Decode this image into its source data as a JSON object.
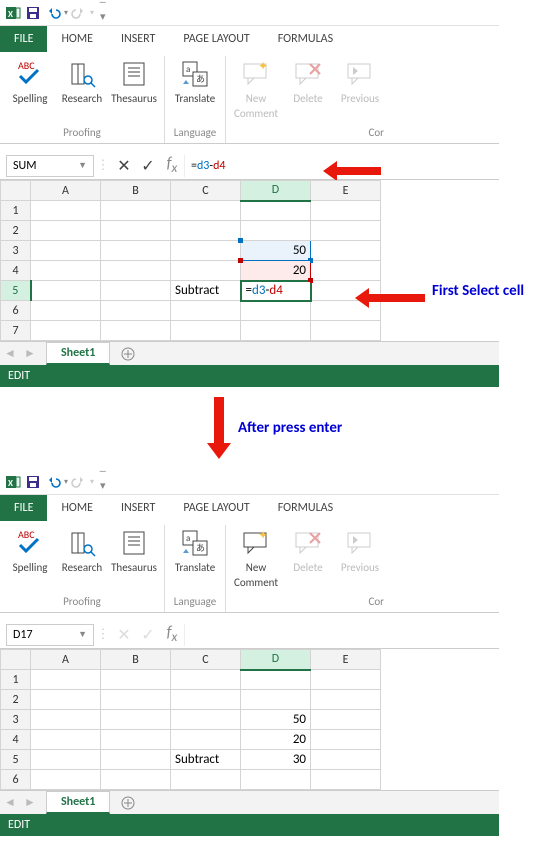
{
  "titlebar": {},
  "menubar": {
    "file": "FILE",
    "home": "HOME",
    "insert": "INSERT",
    "pagelayout": "PAGE LAYOUT",
    "formulas": "FORMULAS"
  },
  "ribbon": {
    "spelling": "Spelling",
    "research": "Research",
    "thesaurus": "Thesaurus",
    "translate": "Translate",
    "newcomment": "New Comment",
    "delete": "Delete",
    "previous": "Previous",
    "proofing_label": "Proofing",
    "language_label": "Language",
    "comments_label_trunc": "Cor",
    "newcomment_line1": "New",
    "newcomment_line2": "Comment"
  },
  "formulabar1": {
    "namebox": "SUM",
    "formula_d3": "d3",
    "formula_d4": "d4"
  },
  "formulabar2": {
    "namebox": "D17"
  },
  "grid": {
    "cols": [
      "A",
      "B",
      "C",
      "D",
      "E"
    ],
    "rows": [
      "1",
      "2",
      "3",
      "4",
      "5",
      "6",
      "7"
    ],
    "data1": {
      "c5": "Subtract",
      "d3": "50",
      "d4": "20",
      "d5_formula_eq": "=",
      "d5_formula_d3": "d3",
      "d5_formula_op": "-",
      "d5_formula_d4": "d4"
    },
    "rows2": [
      "1",
      "2",
      "3",
      "4",
      "5",
      "6"
    ],
    "data2": {
      "c5": "Subtract",
      "d3": "50",
      "d4": "20",
      "d5": "30"
    }
  },
  "sheets": {
    "sheet1": "Sheet1"
  },
  "status": {
    "edit": "EDIT"
  },
  "annotations": {
    "first_select": "First Select cell",
    "after_enter": "After press enter"
  }
}
